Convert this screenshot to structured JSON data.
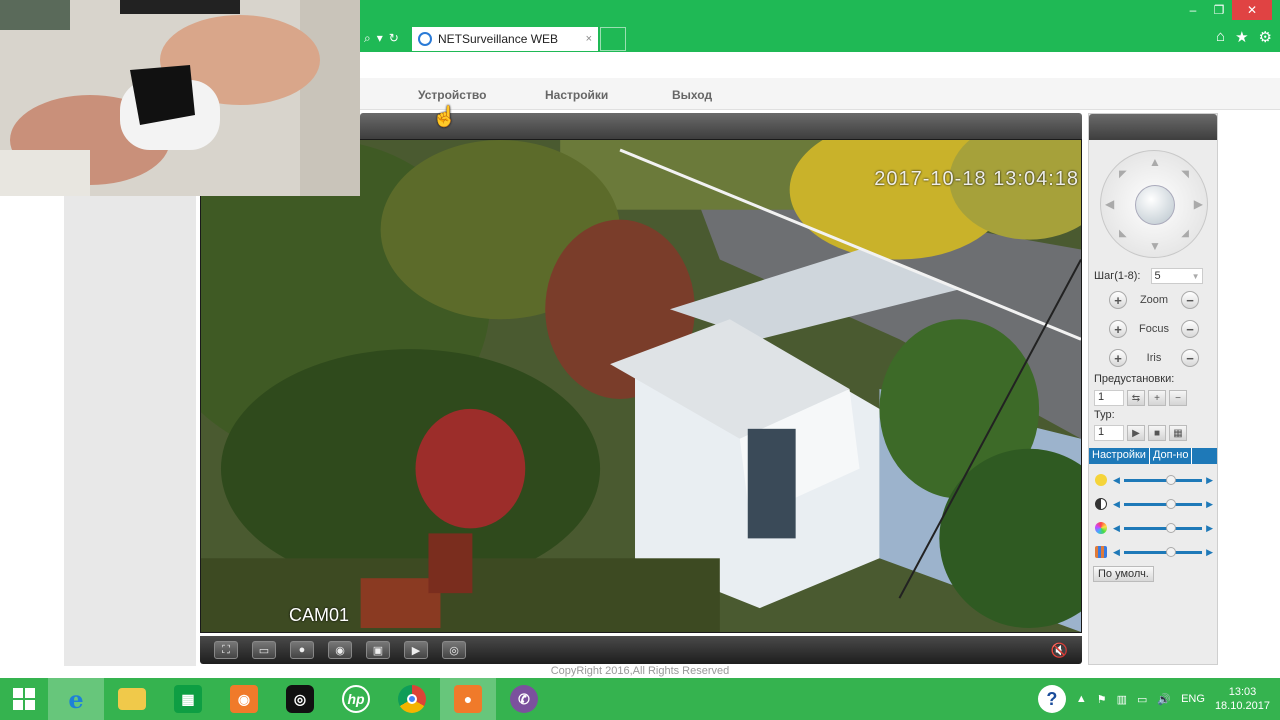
{
  "browser": {
    "tab_title": "NETSurveillance WEB",
    "tab_close": "×",
    "window_controls": [
      "–",
      "❐",
      "✕"
    ],
    "toolbar_icons": [
      "home-icon",
      "star-icon",
      "gear-icon"
    ]
  },
  "menu": {
    "items": [
      "Устройство",
      "Настройки",
      "Выход"
    ]
  },
  "video": {
    "timestamp": "2017-10-18 13:04:18",
    "camera_label": "CAM01"
  },
  "ptz": {
    "step_label": "Шаг(1-8):",
    "step_value": "5",
    "zoom_label": "Zoom",
    "focus_label": "Focus",
    "iris_label": "Iris",
    "plus": "+",
    "minus": "−",
    "presets_label": "Предустановки:",
    "presets_value": "1",
    "tour_label": "Тур:",
    "tour_value": "1",
    "tabs": [
      "Настройки",
      "Доп-но"
    ],
    "defaults_button": "По умолч."
  },
  "sliders": [
    {
      "name": "brightness",
      "color": "#f5d43a",
      "value": 0.6
    },
    {
      "name": "contrast",
      "color": "#333333",
      "value": 0.6
    },
    {
      "name": "saturation",
      "color": "#d46bd0",
      "value": 0.6
    },
    {
      "name": "hue",
      "color": "#e07b3a",
      "value": 0.6
    }
  ],
  "footer": {
    "copyright": "CopyRight 2016,All Rights Reserved"
  },
  "taskbar": {
    "apps": [
      "internet-explorer",
      "file-explorer",
      "store",
      "screen-recorder",
      "webcam",
      "hp",
      "chrome",
      "recorder",
      "viber"
    ],
    "language": "ENG",
    "time": "13:03",
    "date": "18.10.2017"
  }
}
